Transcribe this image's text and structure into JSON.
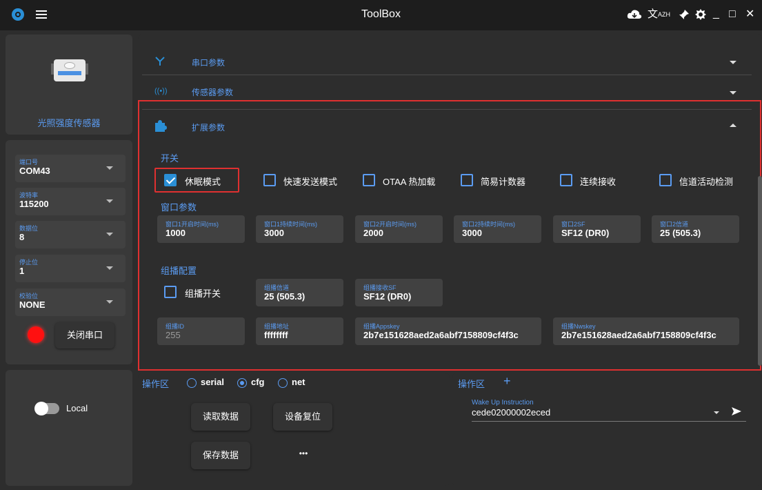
{
  "window": {
    "title": "ToolBox",
    "lang_label": "AZH",
    "minimize": "_",
    "maximize": "□",
    "close": "✕"
  },
  "sensor": {
    "name": "光照强度传感器"
  },
  "serial": {
    "fields": [
      {
        "label": "端口号",
        "value": "COM43"
      },
      {
        "label": "波特率",
        "value": "115200"
      },
      {
        "label": "数据位",
        "value": "8"
      },
      {
        "label": "停止位",
        "value": "1"
      },
      {
        "label": "校验位",
        "value": "NONE"
      }
    ],
    "close_button": "关闭串口"
  },
  "local": {
    "label": "Local"
  },
  "sections": {
    "serial_params": "串口参数",
    "sensor_params": "传感器参数",
    "ext_params": "扩展参数"
  },
  "switches": {
    "heading": "开关",
    "items": [
      {
        "label": "休眠模式",
        "checked": true
      },
      {
        "label": "快速发送模式",
        "checked": false
      },
      {
        "label": "OTAA 热加载",
        "checked": false
      },
      {
        "label": "简易计数器",
        "checked": false
      },
      {
        "label": "连续接收",
        "checked": false
      },
      {
        "label": "信道活动检测",
        "checked": false
      }
    ]
  },
  "window_params": {
    "heading": "窗口参数",
    "fields": [
      {
        "label": "窗口1开启时间(ms)",
        "value": "1000"
      },
      {
        "label": "窗口1持续时间(ms)",
        "value": "3000"
      },
      {
        "label": "窗口2开启时间(ms)",
        "value": "2000"
      },
      {
        "label": "窗口2持续时间(ms)",
        "value": "3000"
      },
      {
        "label": "窗口2SF",
        "value": "SF12 (DR0)"
      },
      {
        "label": "窗口2信道",
        "value": "25 (505.3)"
      }
    ]
  },
  "multicast": {
    "heading": "组播配置",
    "switch_label": "组播开关",
    "channel": {
      "label": "组播信道",
      "value": "25 (505.3)"
    },
    "rx_sf": {
      "label": "组播接收SF",
      "value": "SF12 (DR0)"
    },
    "id": {
      "label": "组播ID",
      "value": "255"
    },
    "addr": {
      "label": "组播地址",
      "value": "ffffffff"
    },
    "appskey": {
      "label": "组播Appskey",
      "value": "2b7e151628aed2a6abf7158809cf4f3c"
    },
    "nwskey": {
      "label": "组播Nwskey",
      "value": "2b7e151628aed2a6abf7158809cf4f3c"
    }
  },
  "operation": {
    "heading": "操作区",
    "modes": [
      "serial",
      "cfg",
      "net"
    ],
    "selected_mode": "cfg",
    "buttons": {
      "read": "读取数据",
      "reset": "设备复位",
      "save": "保存数据",
      "more": "•••"
    }
  },
  "operation_right": {
    "heading": "操作区",
    "add": "+",
    "instruction_label": "Wake Up Instruction",
    "instruction_value": "cede02000002eced"
  },
  "colors": {
    "accent": "#2a8fd6",
    "label_blue": "#5b9cf2",
    "highlight_red": "#e03030"
  }
}
